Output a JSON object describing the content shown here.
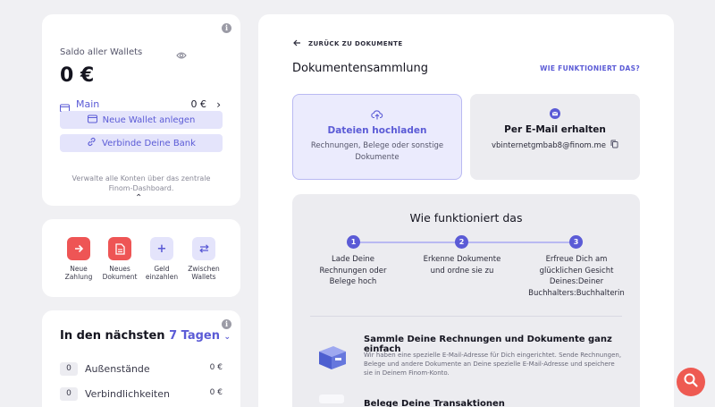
{
  "wallet": {
    "label": "Saldo aller Wallets",
    "balance": "0 €",
    "main_wallet": {
      "label": "Main",
      "amount": "0 €"
    },
    "new_wallet_button": "Neue Wallet anlegen",
    "connect_bank_button": "Verbinde Deine Bank",
    "note": "Verwalte alle Konten über das zentrale Finom-Dashboard."
  },
  "actions": [
    {
      "label": "Neue Zahlung",
      "icon": "arrow-right-icon",
      "style": "red"
    },
    {
      "label": "Neues Dokument",
      "icon": "document-icon",
      "style": "red"
    },
    {
      "label": "Geld einzahlen",
      "icon": "plus-icon",
      "style": "lilac"
    },
    {
      "label": "Zwischen Wallets",
      "icon": "transfer-icon",
      "style": "lilac"
    }
  ],
  "upcoming": {
    "title_prefix": "In den nächsten",
    "title_period": "7 Tagen",
    "rows": [
      {
        "count": "0",
        "label": "Außenstände",
        "amount": "0 €"
      },
      {
        "count": "0",
        "label": "Verbindlichkeiten",
        "amount": "0 €"
      }
    ]
  },
  "main": {
    "back_link": "ZURÜCK ZU DOKUMENTE",
    "title": "Dokumentensammlung",
    "how_link": "WIE FUNKTIONIERT DAS?",
    "upload": {
      "title": "Dateien hochladen",
      "subtitle": "Rechnungen, Belege oder sonstige Dokumente"
    },
    "email": {
      "title": "Per E-Mail erhalten",
      "address": "vbinternetgmbab8@finom.me"
    },
    "how": {
      "title": "Wie funktioniert das",
      "steps": [
        {
          "num": "1",
          "text": "Lade Deine Rechnungen oder Belege hoch"
        },
        {
          "num": "2",
          "text": "Erkenne Dokumente und ordne sie zu"
        },
        {
          "num": "3",
          "text": "Erfreue Dich am glücklichen Gesicht Deines:Deiner Buchhalters:Buchhalterin"
        }
      ],
      "feature1_title": "Sammle Deine Rechnungen und Dokumente ganz einfach",
      "feature1_text": "Wir haben eine spezielle E-Mail-Adresse für Dich eingerichtet. Sende Rechnungen, Belege und andere Dokumente an Deine spezielle E-Mail-Adresse und speichere sie in Deinem Finom-Konto.",
      "feature2_title": "Belege Deine Transaktionen"
    }
  },
  "colors": {
    "accent": "#5b5bd6",
    "action_red": "#ee5555",
    "lilac": "#e4e4fb"
  }
}
